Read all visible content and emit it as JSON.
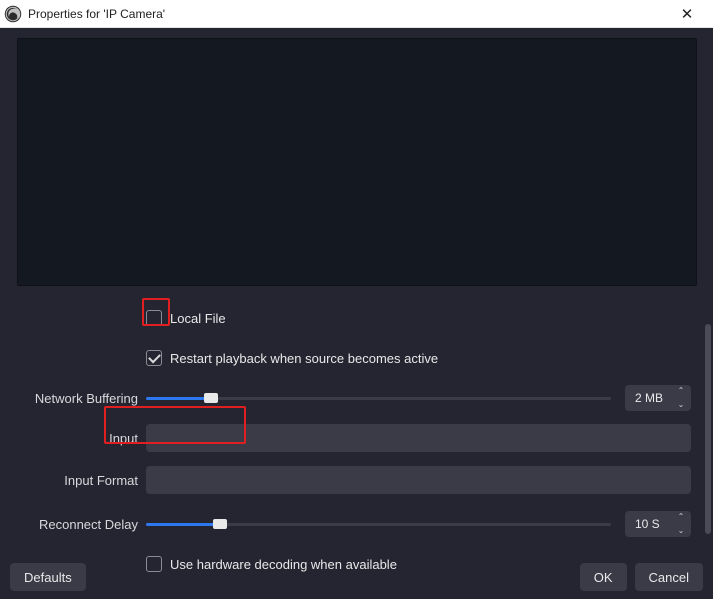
{
  "window": {
    "title": "Properties for 'IP Camera'"
  },
  "fields": {
    "local_file_label": "Local File",
    "restart_playback_label": "Restart playback when source becomes active",
    "network_buffering_label": "Network Buffering",
    "network_buffering_value": "2 MB",
    "input_label": "Input",
    "input_value": "",
    "input_format_label": "Input Format",
    "input_format_value": "",
    "reconnect_delay_label": "Reconnect Delay",
    "reconnect_delay_value": "10 S",
    "hw_decode_label": "Use hardware decoding when available"
  },
  "buttons": {
    "defaults": "Defaults",
    "ok": "OK",
    "cancel": "Cancel"
  }
}
